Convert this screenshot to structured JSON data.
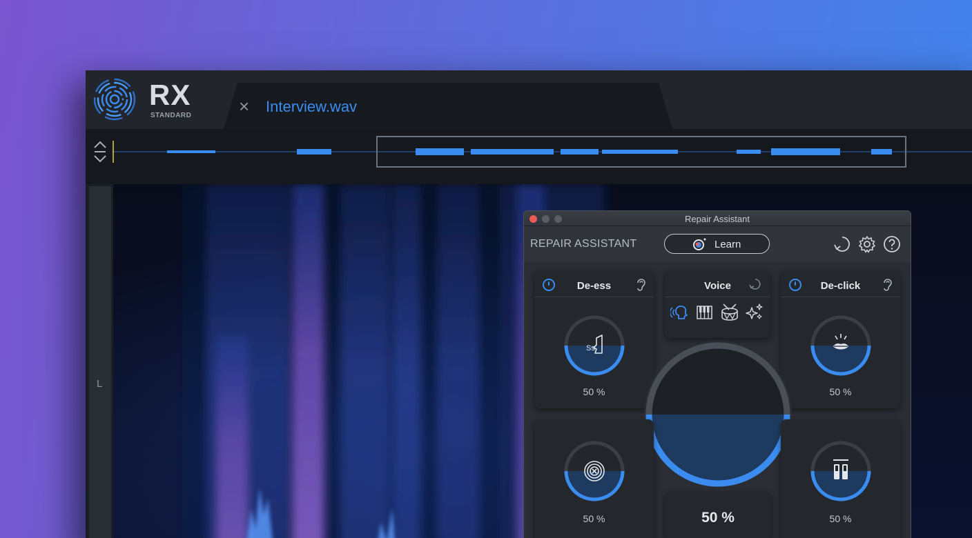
{
  "app": {
    "logo_text": "RX",
    "logo_edition": "STANDARD",
    "file_tab": {
      "title": "Interview.wav",
      "close_glyph": "×"
    },
    "channel_label": "L"
  },
  "repair_assistant": {
    "window_title": "Repair Assistant",
    "header_label": "REPAIR ASSISTANT",
    "learn_button": "Learn",
    "header_icons": [
      "undo-icon",
      "gear-icon",
      "help-icon"
    ],
    "modules": {
      "de_ess": {
        "title": "De-ess",
        "value": "50 %",
        "level": 0.5,
        "icon": "sibilance-icon"
      },
      "voice": {
        "title": "Voice",
        "icons": [
          "voice-icon",
          "piano-icon",
          "drum-icon",
          "sparkle-icon"
        ]
      },
      "de_click": {
        "title": "De-click",
        "value": "50 %",
        "level": 0.5,
        "icon": "mouth-click-icon"
      },
      "denoise": {
        "value": "50 %",
        "level": 0.5,
        "icon": "noise-target-icon"
      },
      "master": {
        "value": "50 %",
        "level": 0.5
      },
      "eq": {
        "value": "50 %",
        "level": 0.5,
        "icon": "level-bars-icon"
      }
    },
    "colors": {
      "accent": "#3b8cf0",
      "knob_fill": "#1f3a5f"
    }
  }
}
